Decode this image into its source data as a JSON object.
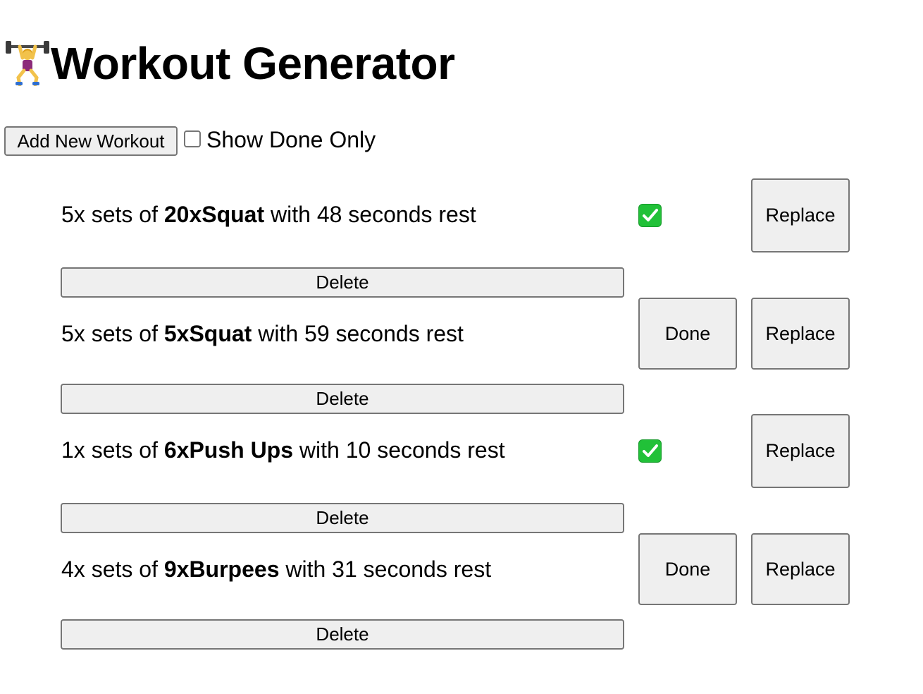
{
  "app": {
    "title": "Workout Generator",
    "title_icon": "weight-lifter-icon"
  },
  "toolbar": {
    "add_label": "Add New Workout",
    "show_done_label": "Show Done Only",
    "show_done_checked": false
  },
  "workouts": [
    {
      "sets": "5x sets of ",
      "exercise": "20xSquat",
      "rest": " with 48 seconds rest",
      "done": true,
      "done_label": "Done",
      "replace_label": "Replace",
      "delete_label": "Delete"
    },
    {
      "sets": "5x sets of ",
      "exercise": "5xSquat",
      "rest": " with 59 seconds rest",
      "done": false,
      "done_label": "Done",
      "replace_label": "Replace",
      "delete_label": "Delete"
    },
    {
      "sets": "1x sets of ",
      "exercise": "6xPush Ups",
      "rest": " with 10 seconds rest",
      "done": true,
      "done_label": "Done",
      "replace_label": "Replace",
      "delete_label": "Delete"
    },
    {
      "sets": "4x sets of ",
      "exercise": "9xBurpees",
      "rest": " with 31 seconds rest",
      "done": false,
      "done_label": "Done",
      "replace_label": "Replace",
      "delete_label": "Delete"
    }
  ],
  "colors": {
    "check_green": "#21c138",
    "button_bg": "#efefef",
    "button_border": "#767676"
  }
}
